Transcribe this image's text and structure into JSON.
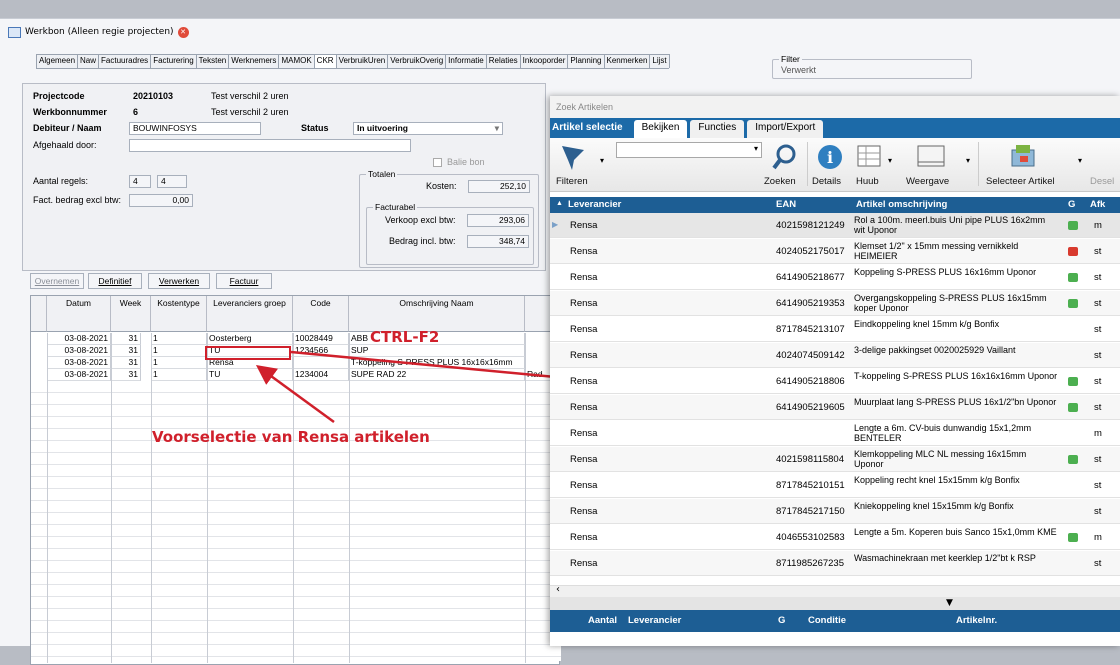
{
  "window": {
    "title": "Werkbon (Alleen regie projecten)"
  },
  "tabs": [
    "Algemeen",
    "Naw",
    "Factuuradres",
    "Facturering",
    "Teksten",
    "Werknemers",
    "MAMOK",
    "CKR",
    "VerbruikUren",
    "VerbruikOverig",
    "Informatie",
    "Relaties",
    "Inkooporder",
    "Planning",
    "Kenmerken",
    "Lijst"
  ],
  "form": {
    "projectcode_label": "Projectcode",
    "projectcode": "20210103",
    "projectcode_desc": "Test verschil 2 uren",
    "werkbonnummer_label": "Werkbonnummer",
    "werkbonnummer": "6",
    "werkbon_desc": "Test verschil 2 uren",
    "debiteur_label": "Debiteur / Naam",
    "debiteur": "BOUWINFOSYS",
    "status_label": "Status",
    "status": "In uitvoering",
    "afgehaald_label": "Afgehaald door:",
    "balie_bon": "Balie bon",
    "aantal_regels_label": "Aantal regels:",
    "aantal_regels_1": "4",
    "aantal_regels_2": "4",
    "fact_label": "Fact. bedrag excl btw:",
    "fact_value": "0,00",
    "filter_label": "Filter",
    "filter_value": "Verwerkt"
  },
  "totalen": {
    "title": "Totalen",
    "kosten_label": "Kosten:",
    "kosten": "252,10",
    "facturabel_title": "Facturabel",
    "verkoop_label": "Verkoop excl btw:",
    "verkoop": "293,06",
    "incl_label": "Bedrag incl. btw:",
    "incl": "348,74"
  },
  "buttons": {
    "overnemen": "Overnemen",
    "definitief": "Definitief",
    "verwerken": "Verwerken",
    "factuur": "Factuur"
  },
  "grid": {
    "headers": [
      "Datum",
      "Week",
      "Kostentype",
      "Leveranciers groep",
      "Code",
      "Omschrijving Naam"
    ],
    "rows": [
      [
        "03-08-2021",
        "31",
        "1",
        "Oosterberg",
        "10028449",
        "ABB"
      ],
      [
        "03-08-2021",
        "31",
        "1",
        "TU",
        "1234566",
        "SUP"
      ],
      [
        "03-08-2021",
        "31",
        "1",
        "Rensa",
        "",
        "T-koppeling S-PRESS PLUS 16x16x16mm"
      ],
      [
        "03-08-2021",
        "31",
        "1",
        "TU",
        "1234004",
        "SUPE RAD 22"
      ]
    ],
    "extra": "Rad"
  },
  "annotations": {
    "shortcut": "CTRL-F2",
    "preselect": "Voorselectie van Rensa artikelen"
  },
  "dialog": {
    "title": "Zoek Artikelen",
    "tabs": [
      "Artikel selectie",
      "Bekijken",
      "Functies",
      "Import/Export"
    ],
    "ribbon": [
      "Filteren",
      "Zoeken",
      "Details",
      "Huub",
      "Weergave",
      "Selecteer Artikel",
      "Desel"
    ],
    "headers": {
      "leverancier": "Leverancier",
      "ean": "EAN",
      "omschrijving": "Artikel omschrijving",
      "g": "G",
      "afk": "Afk"
    },
    "rows": [
      {
        "lev": "Rensa",
        "ean": "4021598121249",
        "oms": "Rol a 100m. meerl.buis Uni pipe PLUS 16x2mm wit Uponor",
        "g": "green",
        "afk": "m"
      },
      {
        "lev": "Rensa",
        "ean": "4024052175017",
        "oms": "Klemset 1/2\" x 15mm messing vernikkeld HEIMEIER",
        "g": "red",
        "afk": "st"
      },
      {
        "lev": "Rensa",
        "ean": "6414905218677",
        "oms": "Koppeling S-PRESS PLUS 16x16mm Uponor",
        "g": "green",
        "afk": "st"
      },
      {
        "lev": "Rensa",
        "ean": "6414905219353",
        "oms": "Overgangskoppeling S-PRESS PLUS 16x15mm koper Uponor",
        "g": "green",
        "afk": "st"
      },
      {
        "lev": "Rensa",
        "ean": "8717845213107",
        "oms": "Eindkoppeling knel 15mm k/g Bonfix",
        "g": "",
        "afk": "st"
      },
      {
        "lev": "Rensa",
        "ean": "4024074509142",
        "oms": "3-delige pakkingset 0020025929 Vaillant",
        "g": "",
        "afk": "st"
      },
      {
        "lev": "Rensa",
        "ean": "6414905218806",
        "oms": "T-koppeling S-PRESS PLUS 16x16x16mm Uponor",
        "g": "green",
        "afk": "st"
      },
      {
        "lev": "Rensa",
        "ean": "6414905219605",
        "oms": "Muurplaat lang S-PRESS PLUS 16x1/2\"bn Uponor",
        "g": "green",
        "afk": "st"
      },
      {
        "lev": "Rensa",
        "ean": "",
        "oms": "Lengte a 6m. CV-buis dunwandig 15x1,2mm BENTELER",
        "g": "",
        "afk": "m"
      },
      {
        "lev": "Rensa",
        "ean": "4021598115804",
        "oms": "Klemkoppeling MLC NL messing 16x15mm Uponor",
        "g": "green",
        "afk": "st"
      },
      {
        "lev": "Rensa",
        "ean": "8717845210151",
        "oms": "Koppeling recht knel 15x15mm k/g Bonfix",
        "g": "",
        "afk": "st"
      },
      {
        "lev": "Rensa",
        "ean": "8717845217150",
        "oms": "Kniekoppeling knel 15x15mm k/g Bonfix",
        "g": "",
        "afk": "st"
      },
      {
        "lev": "Rensa",
        "ean": "4046553102583",
        "oms": "Lengte a 5m. Koperen buis Sanco 15x1,0mm KME",
        "g": "green",
        "afk": "m"
      },
      {
        "lev": "Rensa",
        "ean": "8711985267235",
        "oms": "Wasmachinekraan met keerklep 1/2\"bt k RSP",
        "g": "",
        "afk": "st"
      }
    ],
    "footer": {
      "aantal": "Aantal",
      "leverancier": "Leverancier",
      "g": "G",
      "conditie": "Conditie",
      "artikelnr": "Artikelnr."
    }
  },
  "colors": {
    "accent": "#1d5e94",
    "annotation": "#d0202b",
    "green": "#4caf50",
    "red": "#d83a2e"
  }
}
